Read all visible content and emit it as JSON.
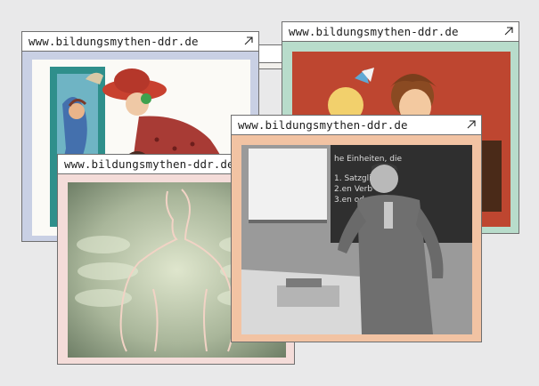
{
  "cards": [
    {
      "url": "www.bildungsmythen-ddr.de",
      "bg": "#c9d0e4"
    },
    {
      "url": "",
      "bg": "#f2f0ec"
    },
    {
      "url": "www.bildungsmythen-ddr.de",
      "bg": "#b8dccb"
    },
    {
      "url": "www.bildungsmythen-ddr.de",
      "bg": "#f4dcd9"
    },
    {
      "url": "www.bildungsmythen-ddr.de",
      "bg": "#f2c3a3"
    }
  ],
  "blackboard": {
    "heading": "he Einheiten, die",
    "lines": [
      "1. Satzglie",
      "2.en Verb",
      "3.en oder"
    ]
  }
}
